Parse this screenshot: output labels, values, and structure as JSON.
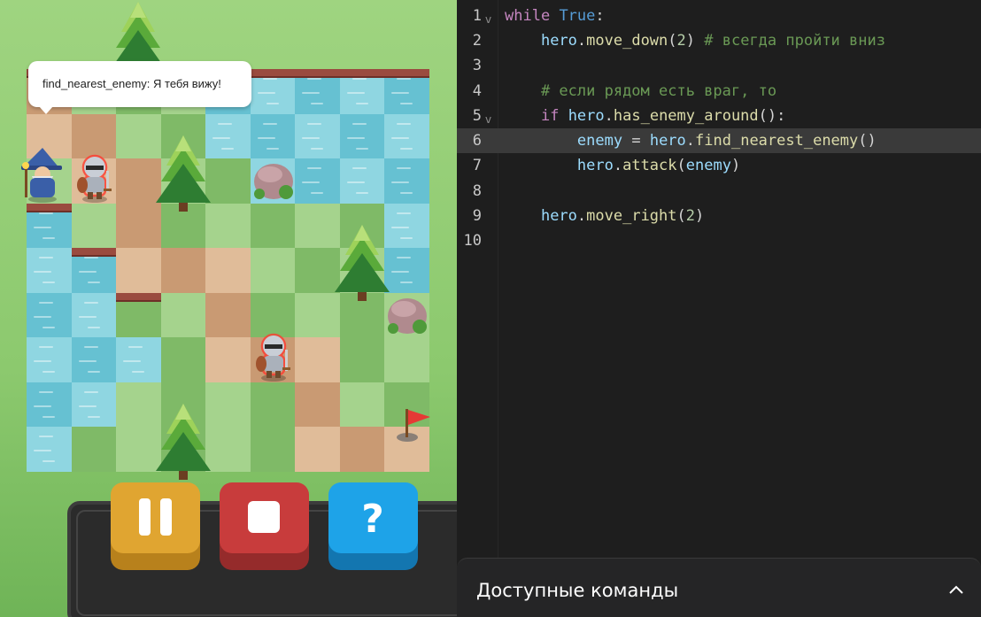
{
  "game": {
    "speech_bubble": "find_nearest_enemy: Я тебя вижу!",
    "board": {
      "cols": 9,
      "rows": 9,
      "tiles": [
        [
          "s1",
          "g2",
          "g1",
          "g2",
          "w1",
          "w2",
          "w1",
          "w2",
          "w1"
        ],
        [
          "s2",
          "s1",
          "g2",
          "g1",
          "w2",
          "w1",
          "w2",
          "w1",
          "w2"
        ],
        [
          "g2",
          "s2",
          "s1",
          "g2",
          "g1",
          "w2",
          "w1",
          "w2",
          "w1"
        ],
        [
          "w1",
          "g2",
          "s1",
          "g1",
          "g2",
          "g1",
          "g2",
          "g1",
          "w2"
        ],
        [
          "w2",
          "w1",
          "s2",
          "s1",
          "s2",
          "g2",
          "g1",
          "g2",
          "w1"
        ],
        [
          "w1",
          "w2",
          "g1",
          "g2",
          "s1",
          "g1",
          "g2",
          "g1",
          "g2"
        ],
        [
          "w2",
          "w1",
          "w2",
          "g1",
          "s2",
          "s1",
          "s2",
          "g1",
          "g2"
        ],
        [
          "w1",
          "w2",
          "g2",
          "g1",
          "g2",
          "g1",
          "s1",
          "g2",
          "g1"
        ],
        [
          "w2",
          "g1",
          "g2",
          "g1",
          "g2",
          "g1",
          "s2",
          "s1",
          "s2"
        ]
      ],
      "banks": [
        [
          0,
          0
        ],
        [
          0,
          5
        ],
        [
          0,
          6
        ],
        [
          0,
          7
        ],
        [
          0,
          8
        ],
        [
          3,
          0
        ],
        [
          4,
          1
        ],
        [
          5,
          2
        ]
      ],
      "trees": [
        [
          -1,
          2
        ],
        [
          2,
          3
        ],
        [
          4,
          7
        ],
        [
          8,
          3
        ]
      ],
      "rocks": [
        [
          2,
          5
        ],
        [
          5,
          8
        ]
      ],
      "hero_cell": [
        2,
        0
      ],
      "enemy_cells": [
        [
          2,
          1
        ],
        [
          6,
          5
        ]
      ],
      "flag_cell": [
        8,
        8
      ]
    },
    "controls": [
      {
        "name": "pause",
        "icon": "pause-icon",
        "face": "#e0a531",
        "base": "#b8811c"
      },
      {
        "name": "stop",
        "icon": "stop-icon",
        "face": "#c83c3c",
        "base": "#952b2b"
      },
      {
        "name": "help",
        "icon": "question-icon",
        "face": "#1ea3e8",
        "base": "#1376b0"
      }
    ]
  },
  "editor": {
    "active_line": 6,
    "lines": [
      {
        "num": "1",
        "fold": true
      },
      {
        "num": "2",
        "fold": false
      },
      {
        "num": "3",
        "fold": false
      },
      {
        "num": "4",
        "fold": false
      },
      {
        "num": "5",
        "fold": true
      },
      {
        "num": "6",
        "fold": false
      },
      {
        "num": "7",
        "fold": false
      },
      {
        "num": "8",
        "fold": false
      },
      {
        "num": "9",
        "fold": false
      },
      {
        "num": "10",
        "fold": false
      }
    ],
    "code": {
      "l1_kw": "while",
      "l1_true": "True",
      "l1_colon": ":",
      "l2_obj": "hero",
      "l2_fn": "move_down",
      "l2_arg": "2",
      "l2_comment": "# всегда пройти вниз",
      "l4_comment": "# если рядом есть враг, то",
      "l5_kw": "if",
      "l5_obj": "hero",
      "l5_fn": "has_enemy_around",
      "l6_var": "enemy",
      "l6_eq": "=",
      "l6_obj": "hero",
      "l6_fn": "find_nearest_enemy",
      "l7_obj": "hero",
      "l7_fn": "attack",
      "l7_arg": "enemy",
      "l9_obj": "hero",
      "l9_fn": "move_right",
      "l9_arg": "2"
    },
    "panel_title": "Доступные команды",
    "panel_icon": "chevron-up-icon"
  }
}
